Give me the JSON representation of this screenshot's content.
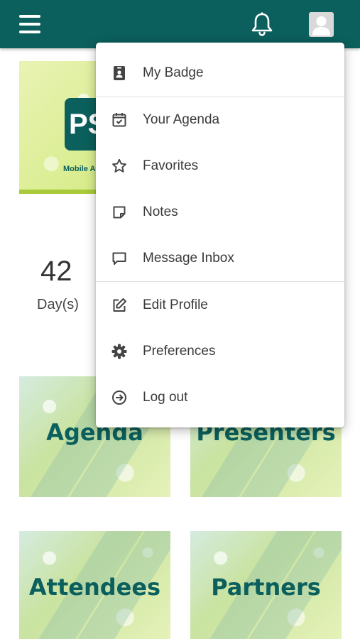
{
  "colors": {
    "topbar": "#0b5f5c",
    "brand": "#0b5f5c",
    "icon": "#444444"
  },
  "header": {
    "menu_icon": "hamburger-menu-icon",
    "notification_icon": "bell-icon",
    "profile_icon": "user-avatar-icon"
  },
  "hero": {
    "logo_text": "PS",
    "caption": "Mobile A"
  },
  "countdown": {
    "value": "42",
    "unit": "Day(s)"
  },
  "tiles": [
    {
      "label": "Agenda"
    },
    {
      "label": "Presenters"
    },
    {
      "label": "Attendees"
    },
    {
      "label": "Partners"
    }
  ],
  "menu": {
    "items": [
      {
        "label": "My Badge",
        "icon": "badge-icon"
      },
      {
        "label": "Your Agenda",
        "icon": "calendar-check-icon"
      },
      {
        "label": "Favorites",
        "icon": "star-icon"
      },
      {
        "label": "Notes",
        "icon": "note-icon"
      },
      {
        "label": "Message Inbox",
        "icon": "chat-bubble-icon"
      },
      {
        "label": "Edit Profile",
        "icon": "edit-icon"
      },
      {
        "label": "Preferences",
        "icon": "gear-icon"
      },
      {
        "label": "Log out",
        "icon": "logout-arrow-icon"
      }
    ]
  }
}
